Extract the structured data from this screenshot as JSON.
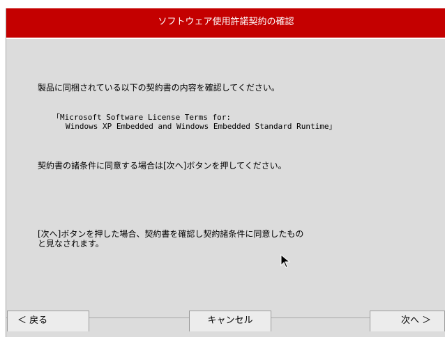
{
  "dialog": {
    "title": "ソフトウェア使用許諾契約の確認"
  },
  "body": {
    "intro": "製品に同梱されている以下の契約書の内容を確認してください。",
    "license_line1": "「Microsoft Software License Terms for:",
    "license_line2": "Windows XP Embedded and Windows Embedded Standard Runtime」",
    "instruction": "契約書の諸条件に同意する場合は[次へ]ボタンを押してください。",
    "note_line1": "[次へ]ボタンを押した場合、契約書を確認し契約諸条件に同意したもの",
    "note_line2": "と見なされます。"
  },
  "buttons": {
    "back": "＜ 戻る",
    "cancel": "キャンセル",
    "next": "次へ ＞"
  },
  "colors": {
    "titlebar": "#c40000",
    "background": "#dcdcdc"
  }
}
